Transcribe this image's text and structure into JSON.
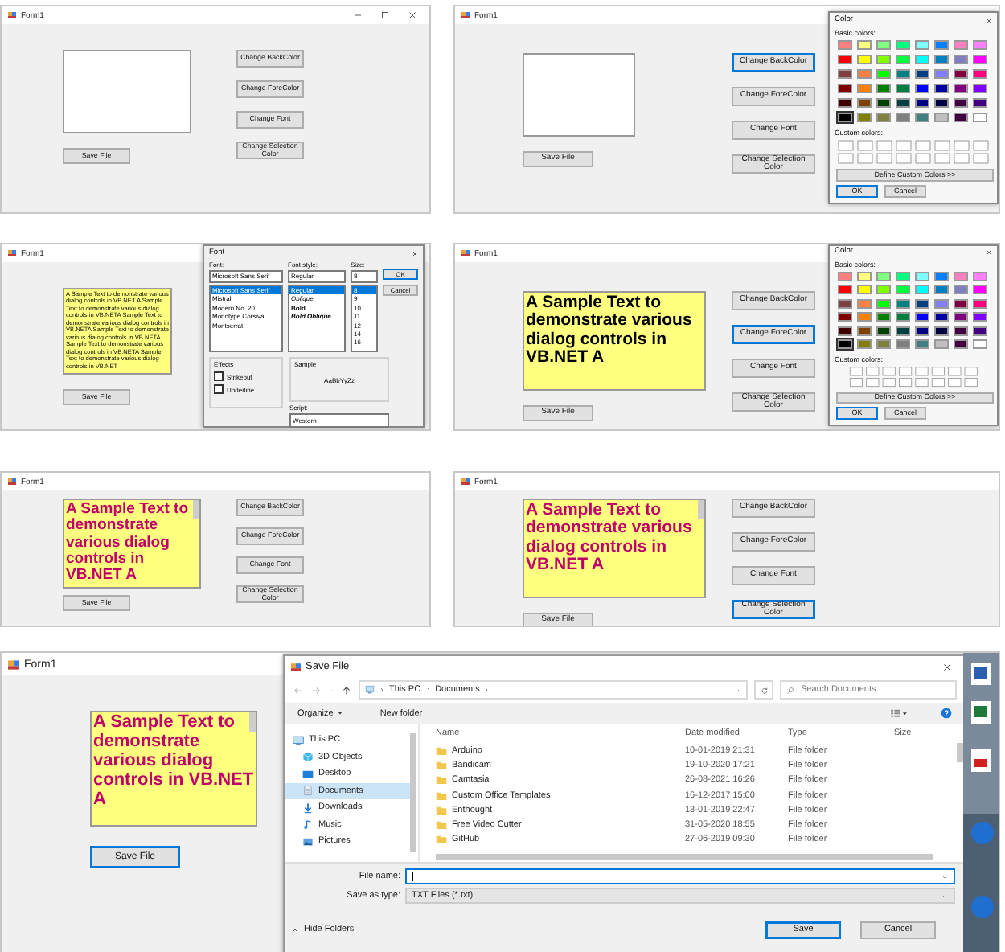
{
  "panels": [
    {
      "title": "Form1",
      "controls_shown": true,
      "textbox": {
        "kind": "empty"
      },
      "buttons": [
        {
          "label": "Change BackColor",
          "selected": false
        },
        {
          "label": "Change ForeColor",
          "selected": false
        },
        {
          "label": "Change Font",
          "selected": false
        },
        {
          "label": "Change Selection Color",
          "selected": false
        }
      ],
      "save_button": {
        "label": "Save File",
        "selected": false
      }
    },
    {
      "title": "Form1",
      "textbox": {
        "kind": "empty"
      },
      "buttons": [
        {
          "label": "Change BackColor",
          "selected": true
        },
        {
          "label": "Change ForeColor",
          "selected": false
        },
        {
          "label": "Change Font",
          "selected": false
        },
        {
          "label": "Change Selection Color",
          "selected": false
        }
      ],
      "save_button": {
        "label": "Save File",
        "selected": false
      },
      "dialog": {
        "kind": "color",
        "title": "Color",
        "basic_label": "Basic colors:",
        "custom_label": "Custom colors:",
        "define_button": "Define Custom Colors >>",
        "ok_button": "OK",
        "cancel_button": "Cancel",
        "swatches": [
          {
            "color": "#ff8080",
            "selected": false
          },
          {
            "color": "#ffff80",
            "selected": false
          },
          {
            "color": "#80ff80",
            "selected": false
          },
          {
            "color": "#00ff80",
            "selected": false
          },
          {
            "color": "#80ffff",
            "selected": false
          },
          {
            "color": "#0080ff",
            "selected": false
          },
          {
            "color": "#ff80c0",
            "selected": false
          },
          {
            "color": "#ff80ff",
            "selected": false
          },
          {
            "color": "#ff0000",
            "selected": false
          },
          {
            "color": "#ffff00",
            "selected": false
          },
          {
            "color": "#80ff00",
            "selected": false
          },
          {
            "color": "#00ff40",
            "selected": false
          },
          {
            "color": "#00ffff",
            "selected": false
          },
          {
            "color": "#0080c0",
            "selected": false
          },
          {
            "color": "#8080c0",
            "selected": false
          },
          {
            "color": "#ff00ff",
            "selected": false
          },
          {
            "color": "#804040",
            "selected": false
          },
          {
            "color": "#ff8040",
            "selected": false
          },
          {
            "color": "#00ff00",
            "selected": false
          },
          {
            "color": "#008080",
            "selected": false
          },
          {
            "color": "#004080",
            "selected": false
          },
          {
            "color": "#8080ff",
            "selected": false
          },
          {
            "color": "#800040",
            "selected": false
          },
          {
            "color": "#ff0080",
            "selected": false
          },
          {
            "color": "#800000",
            "selected": false
          },
          {
            "color": "#ff8000",
            "selected": false
          },
          {
            "color": "#008000",
            "selected": false
          },
          {
            "color": "#008040",
            "selected": false
          },
          {
            "color": "#0000ff",
            "selected": false
          },
          {
            "color": "#0000a0",
            "selected": false
          },
          {
            "color": "#800080",
            "selected": false
          },
          {
            "color": "#8000ff",
            "selected": false
          },
          {
            "color": "#400000",
            "selected": false
          },
          {
            "color": "#804000",
            "selected": false
          },
          {
            "color": "#004000",
            "selected": false
          },
          {
            "color": "#004040",
            "selected": false
          },
          {
            "color": "#000080",
            "selected": false
          },
          {
            "color": "#000040",
            "selected": false
          },
          {
            "color": "#400040",
            "selected": false
          },
          {
            "color": "#400080",
            "selected": false
          },
          {
            "color": "#000000",
            "selected": true
          },
          {
            "color": "#808000",
            "selected": false
          },
          {
            "color": "#808040",
            "selected": false
          },
          {
            "color": "#808080",
            "selected": false
          },
          {
            "color": "#408080",
            "selected": false
          },
          {
            "color": "#c0c0c0",
            "selected": false
          },
          {
            "color": "#400040",
            "selected": false
          },
          {
            "color": "#ffffff",
            "selected": false
          }
        ]
      }
    },
    {
      "title": "Form1",
      "textbox": {
        "kind": "small",
        "text": "A Sample Text to demonstrate various dialog controls in VB.NET A Sample Text to demonstrate various dialog controls in VB.NETA Sample Text to demonstrate various dialog controls in VB.NETA Sample Text to demonstrate various dialog controls in VB.NETA Sample Text to demonstrate various dialog controls in VB.NETA Sample Text to demonstrate various dialog controls in VB.NET"
      },
      "save_button": {
        "label": "Save File",
        "selected": false
      },
      "dialog": {
        "kind": "font",
        "title": "Font",
        "font_label": "Font:",
        "style_label": "Font style:",
        "size_label": "Size:",
        "font_value": "Microsoft Sans Serif",
        "style_value": "Regular",
        "size_value": "8",
        "fonts": [
          {
            "label": "Microsoft Sans Serif",
            "selected": true
          },
          {
            "label": "Mistral",
            "selected": false
          },
          {
            "label": "Modern No. 20",
            "selected": false
          },
          {
            "label": "Monotype Corsiva",
            "selected": false
          },
          {
            "label": "Montserrat",
            "selected": false
          }
        ],
        "styles": [
          {
            "label": "Regular",
            "selected": true
          },
          {
            "label": "Oblique",
            "selected": false
          },
          {
            "label": "Bold",
            "selected": false
          },
          {
            "label": "Bold Oblique",
            "selected": false
          }
        ],
        "sizes": [
          {
            "label": "8",
            "selected": true
          },
          {
            "label": "9",
            "selected": false
          },
          {
            "label": "10",
            "selected": false
          },
          {
            "label": "11",
            "selected": false
          },
          {
            "label": "12",
            "selected": false
          },
          {
            "label": "14",
            "selected": false
          },
          {
            "label": "16",
            "selected": false
          }
        ],
        "ok_button": "OK",
        "cancel_button": "Cancel",
        "effects_label": "Effects",
        "effects": [
          {
            "label": "Strikeout",
            "checked": false
          },
          {
            "label": "Underline",
            "checked": false
          }
        ],
        "sample_label": "Sample",
        "sample_text": "AaBbYyZz",
        "script_label": "Script:",
        "script_value": "Western"
      }
    },
    {
      "title": "Form1",
      "textbox": {
        "kind": "large",
        "color": "#000000",
        "text": "A Sample Text to demonstrate various dialog controls in VB.NET A"
      },
      "buttons": [
        {
          "label": "Change BackColor",
          "selected": false
        },
        {
          "label": "Change ForeColor",
          "selected": true
        },
        {
          "label": "Change Font",
          "selected": false
        },
        {
          "label": "Change Selection Color",
          "selected": false
        }
      ],
      "save_button": {
        "label": "Save File",
        "selected": false
      },
      "dialog": {
        "kind": "color",
        "title": "Color",
        "basic_label": "Basic colors:",
        "custom_label": "Custom colors:",
        "define_button": "Define Custom Colors >>",
        "ok_button": "OK",
        "cancel_button": "Cancel",
        "swatches": [
          {
            "color": "#ff8080",
            "selected": false
          },
          {
            "color": "#ffff80",
            "selected": false
          },
          {
            "color": "#80ff80",
            "selected": false
          },
          {
            "color": "#00ff80",
            "selected": false
          },
          {
            "color": "#80ffff",
            "selected": false
          },
          {
            "color": "#0080ff",
            "selected": false
          },
          {
            "color": "#ff80c0",
            "selected": false
          },
          {
            "color": "#ff80ff",
            "selected": false
          },
          {
            "color": "#ff0000",
            "selected": false
          },
          {
            "color": "#ffff00",
            "selected": false
          },
          {
            "color": "#80ff00",
            "selected": false
          },
          {
            "color": "#00ff40",
            "selected": false
          },
          {
            "color": "#00ffff",
            "selected": false
          },
          {
            "color": "#0080c0",
            "selected": false
          },
          {
            "color": "#8080c0",
            "selected": false
          },
          {
            "color": "#ff00ff",
            "selected": false
          },
          {
            "color": "#804040",
            "selected": false
          },
          {
            "color": "#ff8040",
            "selected": false
          },
          {
            "color": "#00ff00",
            "selected": false
          },
          {
            "color": "#008080",
            "selected": false
          },
          {
            "color": "#004080",
            "selected": false
          },
          {
            "color": "#8080ff",
            "selected": false
          },
          {
            "color": "#800040",
            "selected": false
          },
          {
            "color": "#ff0080",
            "selected": false
          },
          {
            "color": "#800000",
            "selected": false
          },
          {
            "color": "#ff8000",
            "selected": false
          },
          {
            "color": "#008000",
            "selected": false
          },
          {
            "color": "#008040",
            "selected": false
          },
          {
            "color": "#0000ff",
            "selected": false
          },
          {
            "color": "#0000a0",
            "selected": false
          },
          {
            "color": "#800080",
            "selected": false
          },
          {
            "color": "#8000ff",
            "selected": false
          },
          {
            "color": "#400000",
            "selected": false
          },
          {
            "color": "#804000",
            "selected": false
          },
          {
            "color": "#004000",
            "selected": false
          },
          {
            "color": "#004040",
            "selected": false
          },
          {
            "color": "#000080",
            "selected": false
          },
          {
            "color": "#000040",
            "selected": false
          },
          {
            "color": "#400040",
            "selected": false
          },
          {
            "color": "#400080",
            "selected": false
          },
          {
            "color": "#000000",
            "selected": true
          },
          {
            "color": "#808000",
            "selected": false
          },
          {
            "color": "#808040",
            "selected": false
          },
          {
            "color": "#808080",
            "selected": false
          },
          {
            "color": "#408080",
            "selected": false
          },
          {
            "color": "#c0c0c0",
            "selected": false
          },
          {
            "color": "#400040",
            "selected": false
          },
          {
            "color": "#ffffff",
            "selected": false
          }
        ]
      }
    },
    {
      "title": "Form1",
      "textbox": {
        "kind": "large",
        "scrollbar": true,
        "color": "#c0006a",
        "text": "A Sample Text to demonstrate various dialog controls in VB.NET A"
      },
      "buttons": [
        {
          "label": "Change BackColor",
          "selected": false
        },
        {
          "label": "Change ForeColor",
          "selected": false
        },
        {
          "label": "Change Font",
          "selected": false
        },
        {
          "label": "Change Selection Color",
          "selected": false
        }
      ],
      "save_button": {
        "label": "Save File",
        "selected": false
      }
    },
    {
      "title": "Form1",
      "textbox": {
        "kind": "large",
        "scrollbar": true,
        "color": "#c0006a",
        "text": "A Sample Text to demonstrate various dialog controls in VB.NET A"
      },
      "buttons": [
        {
          "label": "Change BackColor",
          "selected": false
        },
        {
          "label": "Change ForeColor",
          "selected": false
        },
        {
          "label": "Change Font",
          "selected": false
        },
        {
          "label": "Change Selection Color",
          "selected": true
        }
      ],
      "save_button": {
        "label": "Save File",
        "selected": false
      }
    },
    {
      "title": "Form1",
      "textbox": {
        "kind": "large",
        "scrollbar": true,
        "color": "#c0006a",
        "text": "A Sample Text to demonstrate various dialog controls in VB.NET A"
      },
      "save_button": {
        "label": "Save File",
        "selected": true
      },
      "dialog": {
        "kind": "save",
        "title": "Save File",
        "path": [
          {
            "label": "This PC"
          },
          {
            "label": "Documents"
          }
        ],
        "search_placeholder": "Search Documents",
        "organize": "Organize",
        "new_folder": "New folder",
        "nav": [
          {
            "kind": "pc",
            "label": "This PC",
            "selected": false
          },
          {
            "kind": "objects",
            "label": "3D Objects",
            "selected": false
          },
          {
            "kind": "desktop",
            "label": "Desktop",
            "selected": false
          },
          {
            "kind": "documents",
            "label": "Documents",
            "selected": true
          },
          {
            "kind": "downloads",
            "label": "Downloads",
            "selected": false
          },
          {
            "kind": "music",
            "label": "Music",
            "selected": false
          },
          {
            "kind": "pictures",
            "label": "Pictures",
            "selected": false
          }
        ],
        "columns": [
          "Name",
          "Date modified",
          "Type",
          "Size"
        ],
        "rows": [
          {
            "name": "Arduino",
            "date": "10-01-2019 21:31",
            "type": "File folder"
          },
          {
            "name": "Bandicam",
            "date": "19-10-2020 17:21",
            "type": "File folder"
          },
          {
            "name": "Camtasia",
            "date": "26-08-2021 16:26",
            "type": "File folder"
          },
          {
            "name": "Custom Office Templates",
            "date": "16-12-2017 15:00",
            "type": "File folder"
          },
          {
            "name": "Enthought",
            "date": "13-01-2019 22:47",
            "type": "File folder"
          },
          {
            "name": "Free Video Cutter",
            "date": "31-05-2020 18:55",
            "type": "File folder"
          },
          {
            "name": "GitHub",
            "date": "27-06-2019 09:30",
            "type": "File folder"
          }
        ],
        "file_name_label": "File name:",
        "type_label": "Save as type:",
        "type_value": "TXT Files (*.txt)",
        "hide_folders": "Hide Folders",
        "save_button": "Save",
        "cancel_button": "Cancel"
      }
    }
  ]
}
